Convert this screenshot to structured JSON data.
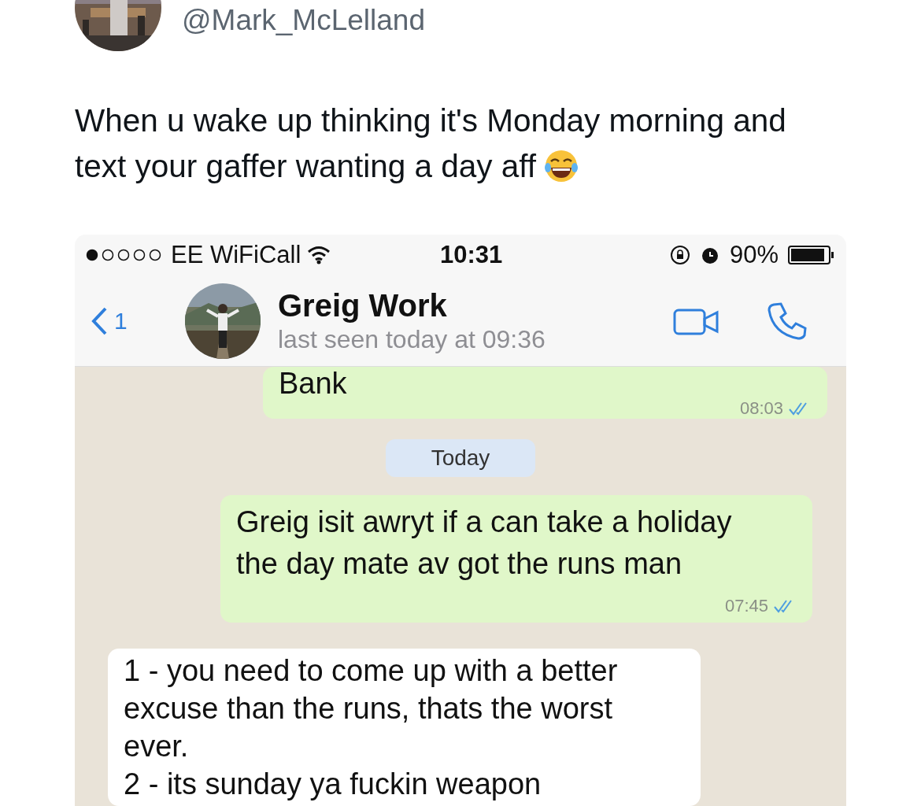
{
  "tweet": {
    "handle": "@Mark_McLelland",
    "text": "When u wake up thinking it's Monday morning and text your gaffer wanting a day aff"
  },
  "screenshot": {
    "status_bar": {
      "carrier": "EE WiFiCall",
      "time": "10:31",
      "battery": "90%"
    },
    "chat_header": {
      "back_count": "1",
      "contact_name": "Greig Work",
      "last_seen": "last seen today at 09:36"
    },
    "messages": [
      {
        "kind": "outgoing",
        "text": "Bank",
        "time": "08:03",
        "read": true
      },
      {
        "kind": "date",
        "text": "Today"
      },
      {
        "kind": "outgoing",
        "text": "Greig isit awryt if a can take a holiday the day mate av got the runs man",
        "time": "07:45",
        "read": true
      },
      {
        "kind": "incoming",
        "text": "1 - you need to come up with a better excuse than the runs, thats the worst ever.\n2 - its sunday ya fuckin weapon"
      }
    ]
  }
}
